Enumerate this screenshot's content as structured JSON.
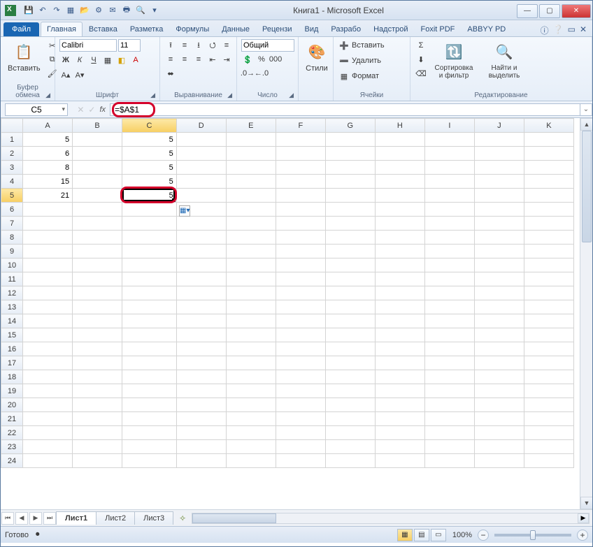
{
  "window": {
    "title": "Книга1  -  Microsoft Excel"
  },
  "qat": {
    "save": "💾",
    "undo": "↶",
    "redo": "↷",
    "new": "▦",
    "open": "📂",
    "quick": "⚙",
    "mail": "✉",
    "print": "🖶",
    "preview": "🔍"
  },
  "tabs": {
    "file": "Файл",
    "items": [
      "Главная",
      "Вставка",
      "Разметка",
      "Формулы",
      "Данные",
      "Рецензи",
      "Вид",
      "Разрабо",
      "Надстрой",
      "Foxit PDF",
      "ABBYY PD"
    ],
    "active": 0
  },
  "ribbon": {
    "clipboard": {
      "paste": "Вставить",
      "label": "Буфер обмена"
    },
    "font": {
      "name": "Calibri",
      "size": "11",
      "label": "Шрифт",
      "bold": "Ж",
      "italic": "К",
      "underline": "Ч"
    },
    "alignment": {
      "label": "Выравнивание",
      "wrap": "≡",
      "merge": "⬌"
    },
    "number": {
      "format": "Общий",
      "label": "Число"
    },
    "styles": {
      "label": "Стили",
      "btn": "Стили"
    },
    "cells": {
      "insert": "Вставить",
      "delete": "Удалить",
      "format": "Формат",
      "label": "Ячейки"
    },
    "editing": {
      "sort": "Сортировка и фильтр",
      "find": "Найти и выделить",
      "label": "Редактирование"
    }
  },
  "formula_bar": {
    "name_box": "C5",
    "formula": "=$A$1"
  },
  "columns": [
    "A",
    "B",
    "C",
    "D",
    "E",
    "F",
    "G",
    "H",
    "I",
    "J",
    "K"
  ],
  "rows": 24,
  "selected": {
    "col": "C",
    "row": 5
  },
  "cells": {
    "A1": "5",
    "A2": "6",
    "A3": "8",
    "A4": "15",
    "A5": "21",
    "C1": "5",
    "C2": "5",
    "C3": "5",
    "C4": "5",
    "C5": "5"
  },
  "sheets": {
    "items": [
      "Лист1",
      "Лист2",
      "Лист3"
    ],
    "active": 0
  },
  "status": {
    "ready": "Готово",
    "zoom": "100%"
  }
}
